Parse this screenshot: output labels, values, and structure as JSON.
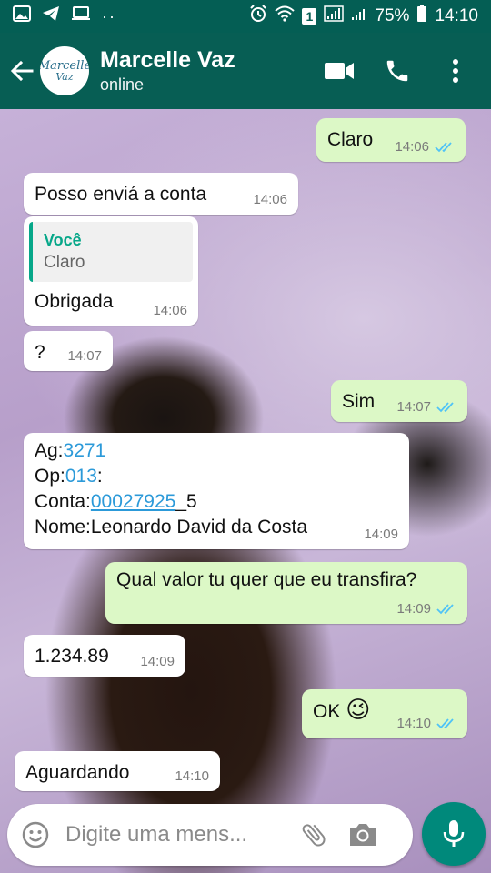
{
  "status_bar": {
    "battery": "75%",
    "time": "14:10",
    "sim": "1"
  },
  "header": {
    "contact_name": "Marcelle Vaz",
    "presence": "online",
    "avatar_text_1": "Marcelle",
    "avatar_text_2": "Vaz"
  },
  "messages": [
    {
      "dir": "out",
      "text": "Claro",
      "time": "14:06"
    },
    {
      "dir": "in",
      "text": "Posso enviá a conta",
      "time": "14:06"
    },
    {
      "dir": "in",
      "quote_author": "Você",
      "quote_text": "Claro",
      "text": "Obrigada",
      "time": "14:06"
    },
    {
      "dir": "in",
      "text": "?",
      "time": "14:07"
    },
    {
      "dir": "out",
      "text": "Sim",
      "time": "14:07"
    },
    {
      "dir": "in",
      "lines": [
        {
          "label": "Ag:",
          "value": "3271",
          "suffix": ""
        },
        {
          "label": "Op:",
          "value": "013",
          "suffix": ":"
        },
        {
          "label": "Conta:",
          "value": "00027925",
          "suffix": "_5"
        },
        {
          "label": "Nome:Leonardo David da Costa",
          "value": "",
          "suffix": ""
        }
      ],
      "time": "14:09"
    },
    {
      "dir": "out",
      "text": "Qual valor tu quer que eu transfira?",
      "time": "14:09"
    },
    {
      "dir": "in",
      "text": "1.234.89",
      "time": "14:09"
    },
    {
      "dir": "out",
      "text": "OK",
      "emoji": "😉",
      "time": "14:10"
    },
    {
      "dir": "in",
      "text": "Aguardando",
      "time": "14:10"
    }
  ],
  "composer": {
    "placeholder": "Digite uma mens..."
  },
  "colors": {
    "header": "#075e54",
    "outgoing_bubble": "#dcf8c6",
    "incoming_bubble": "#ffffff",
    "read_ticks": "#4fc3f7",
    "quote_accent": "#06a789",
    "mic_button": "#00897b"
  },
  "icons": [
    "back-arrow-icon",
    "video-call-icon",
    "phone-icon",
    "more-vert-icon",
    "emoji-icon",
    "attach-icon",
    "camera-icon",
    "mic-icon",
    "read-ticks-icon"
  ]
}
